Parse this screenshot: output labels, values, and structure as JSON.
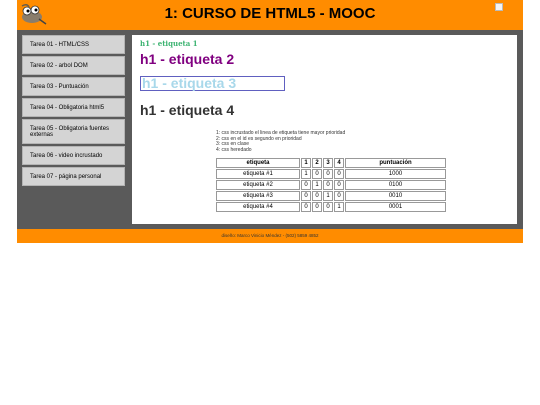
{
  "header": {
    "title": "1: CURSO DE HTML5 - MOOC"
  },
  "sidebar": {
    "items": [
      {
        "label": "Tarea 01 - HTML/CSS"
      },
      {
        "label": "Tarea 02 - arbol DOM"
      },
      {
        "label": "Tarea 03 - Puntuación"
      },
      {
        "label": "Tarea 04 - Obligatoria html5"
      },
      {
        "label": "Tarea 05 - Obligatoria fuentes externas"
      },
      {
        "label": "Tarea 06 - video incrustado"
      },
      {
        "label": "Tarea 07 - página personal"
      }
    ]
  },
  "content": {
    "h1_1": "h1 - etiqueta 1",
    "h1_2": "h1 - etiqueta 2",
    "h1_3": "h1 - etiqueta 3",
    "h1_4": "h1 - etiqueta 4",
    "notes": [
      "1: css incrustado el linea de etiqueta tiene mayor prioridad",
      "2: css en el id es segundo en prioridad",
      "3: css en clase",
      "4: css heredado"
    ],
    "table": {
      "headers": [
        "etiqueta",
        "1",
        "2",
        "3",
        "4",
        "puntuación"
      ],
      "rows": [
        [
          "etiqueta #1",
          "1",
          "0",
          "0",
          "0",
          "1000"
        ],
        [
          "etiqueta #2",
          "0",
          "1",
          "0",
          "0",
          "0100"
        ],
        [
          "etiqueta #3",
          "0",
          "0",
          "1",
          "0",
          "0010"
        ],
        [
          "etiqueta #4",
          "0",
          "0",
          "0",
          "1",
          "0001"
        ]
      ]
    }
  },
  "footer": {
    "text": "diseño: Marco Vinicio Méndez - (502) 5859 4852"
  },
  "colors": {
    "header_bg": "#ff8c00",
    "body_bg": "#5a5a5a",
    "h1_1": "#3cb371",
    "h1_2": "#800080",
    "h1_3": "#a8d8ea",
    "h1_4": "#333333"
  },
  "icons": {
    "logo": "gimp-logo-icon",
    "broken": "broken-image-icon"
  }
}
